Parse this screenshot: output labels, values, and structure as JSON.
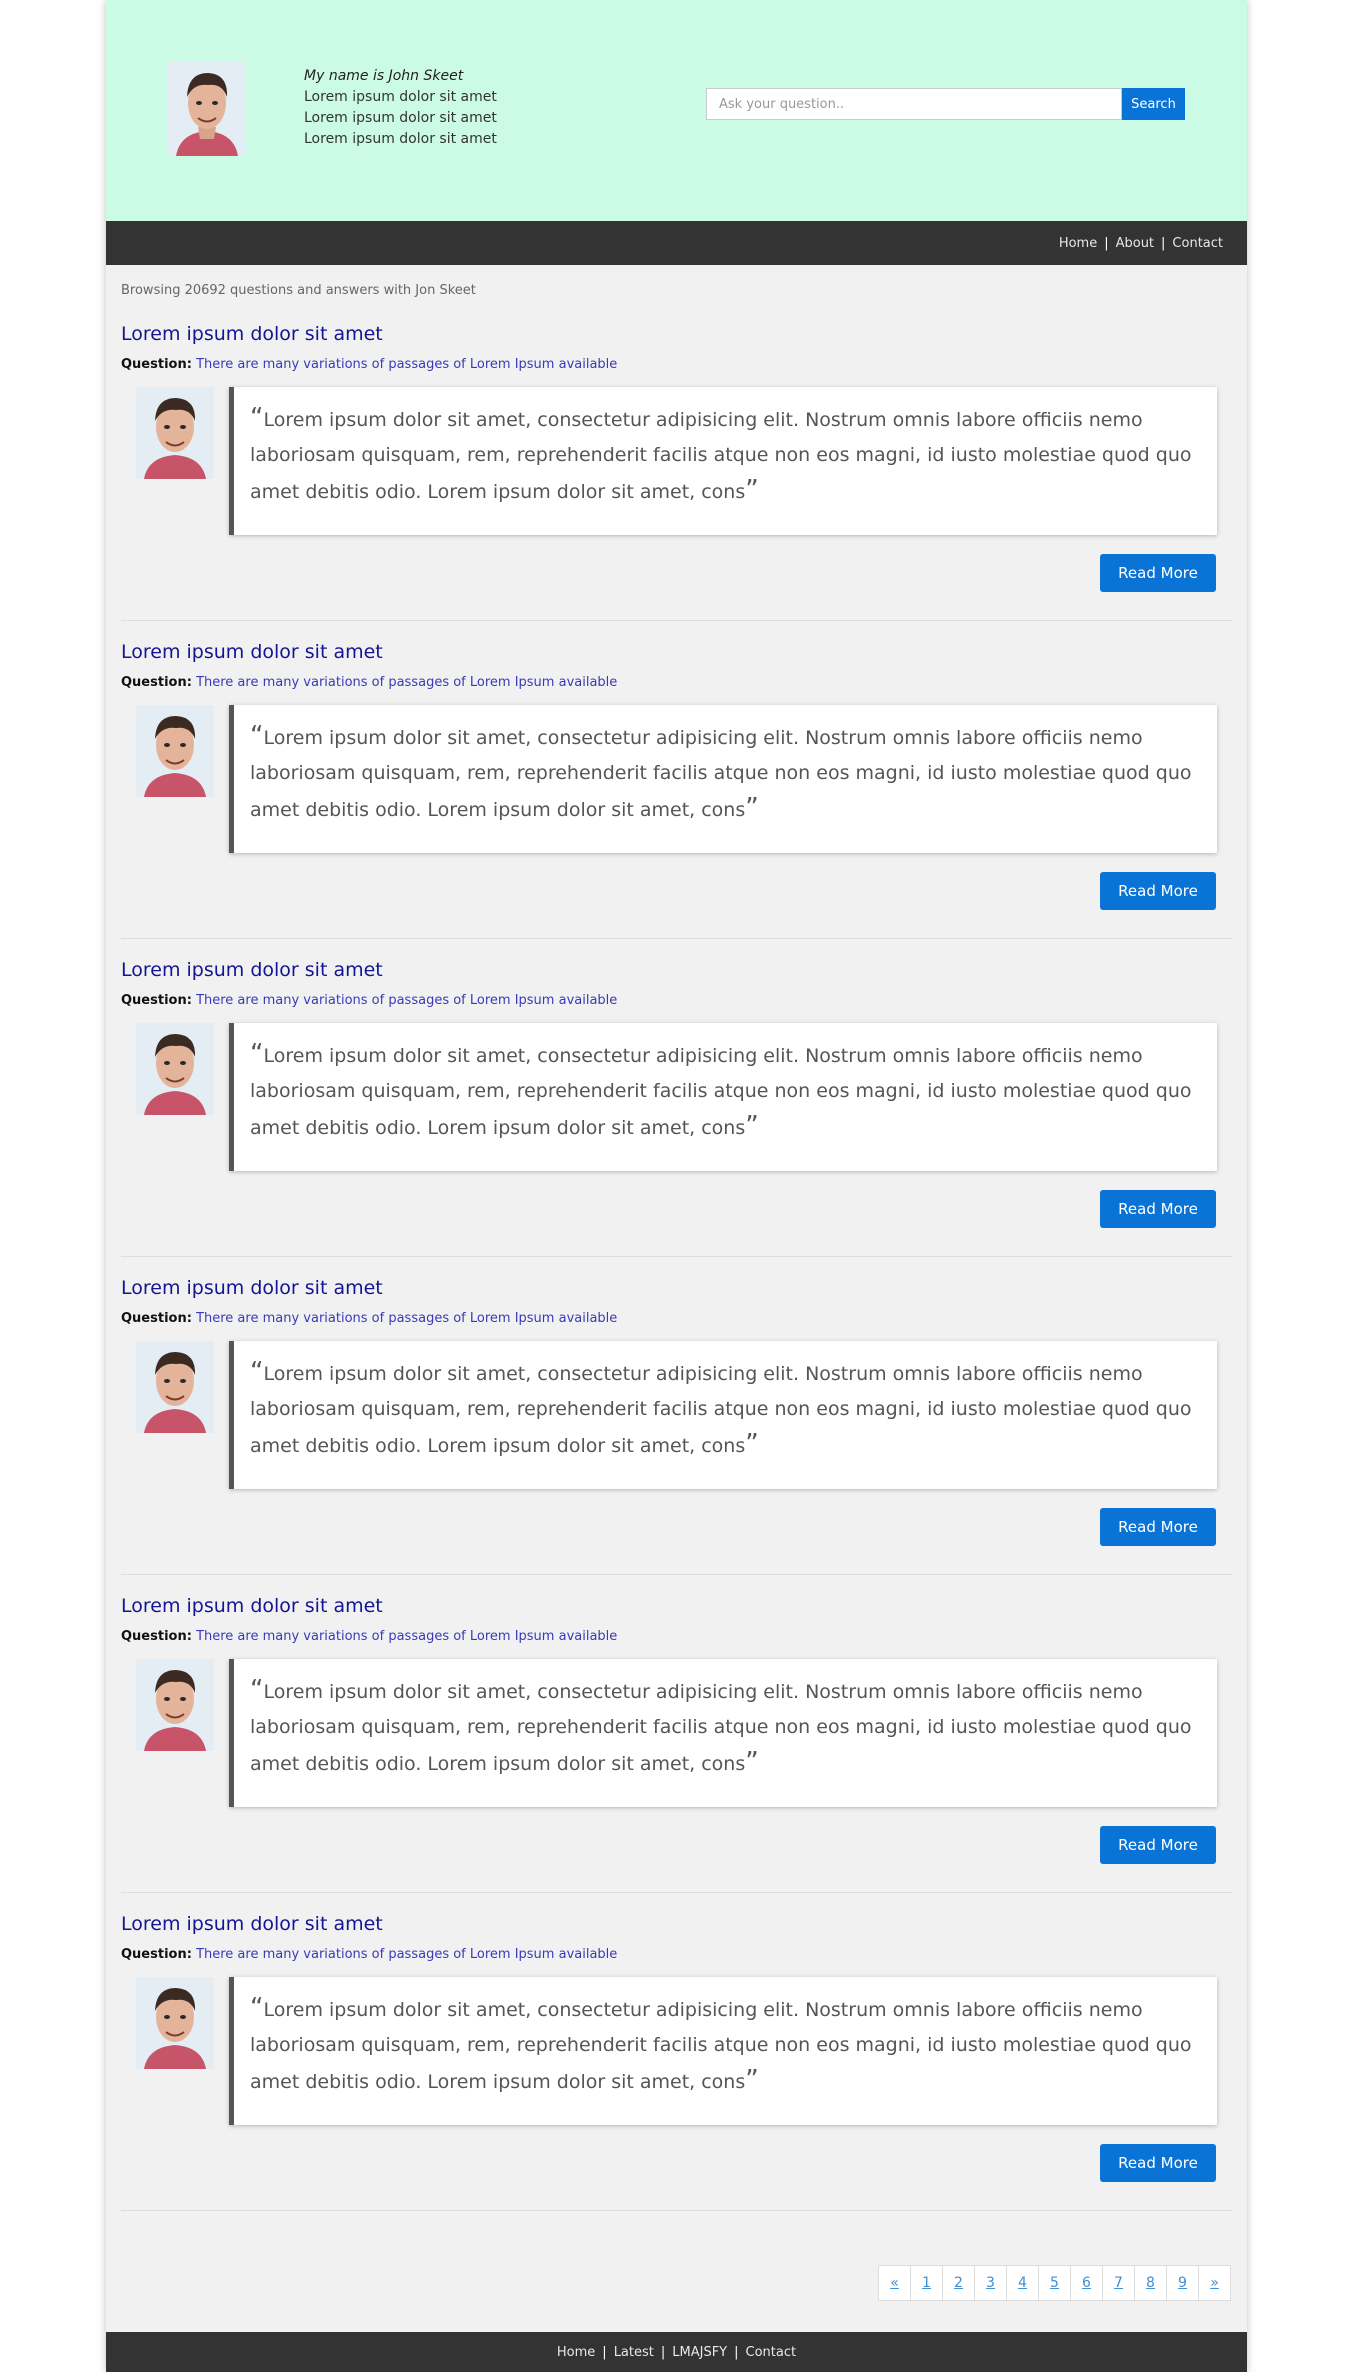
{
  "header": {
    "name": "My name is John Skeet",
    "bio_lines": [
      "Lorem ipsum dolor sit amet",
      "Lorem ipsum dolor sit amet",
      "Lorem ipsum dolor sit amet"
    ],
    "search_placeholder": "Ask your question..",
    "search_button": "Search"
  },
  "nav": {
    "items": [
      "Home",
      "About",
      "Contact"
    ]
  },
  "browse_text": "Browsing 20692 questions and answers with Jon Skeet",
  "qa_items": [
    {
      "title": "Lorem ipsum dolor sit amet",
      "question_label": "Question:",
      "question": "There are many variations of passages of Lorem Ipsum available",
      "answer": "Lorem ipsum dolor sit amet, consectetur adipisicing elit. Nostrum omnis labore officiis nemo laboriosam quisquam, rem, reprehenderit facilis atque non eos magni, id iusto molestiae quod quo amet debitis odio. Lorem ipsum dolor sit amet, cons",
      "button": "Read More"
    },
    {
      "title": "Lorem ipsum dolor sit amet",
      "question_label": "Question:",
      "question": "There are many variations of passages of Lorem Ipsum available",
      "answer": "Lorem ipsum dolor sit amet, consectetur adipisicing elit. Nostrum omnis labore officiis nemo laboriosam quisquam, rem, reprehenderit facilis atque non eos magni, id iusto molestiae quod quo amet debitis odio. Lorem ipsum dolor sit amet, cons",
      "button": "Read More"
    },
    {
      "title": "Lorem ipsum dolor sit amet",
      "question_label": "Question:",
      "question": "There are many variations of passages of Lorem Ipsum available",
      "answer": "Lorem ipsum dolor sit amet, consectetur adipisicing elit. Nostrum omnis labore officiis nemo laboriosam quisquam, rem, reprehenderit facilis atque non eos magni, id iusto molestiae quod quo amet debitis odio. Lorem ipsum dolor sit amet, cons",
      "button": "Read More"
    },
    {
      "title": "Lorem ipsum dolor sit amet",
      "question_label": "Question:",
      "question": "There are many variations of passages of Lorem Ipsum available",
      "answer": "Lorem ipsum dolor sit amet, consectetur adipisicing elit. Nostrum omnis labore officiis nemo laboriosam quisquam, rem, reprehenderit facilis atque non eos magni, id iusto molestiae quod quo amet debitis odio. Lorem ipsum dolor sit amet, cons",
      "button": "Read More"
    },
    {
      "title": "Lorem ipsum dolor sit amet",
      "question_label": "Question:",
      "question": "There are many variations of passages of Lorem Ipsum available",
      "answer": "Lorem ipsum dolor sit amet, consectetur adipisicing elit. Nostrum omnis labore officiis nemo laboriosam quisquam, rem, reprehenderit facilis atque non eos magni, id iusto molestiae quod quo amet debitis odio. Lorem ipsum dolor sit amet, cons",
      "button": "Read More"
    },
    {
      "title": "Lorem ipsum dolor sit amet",
      "question_label": "Question:",
      "question": "There are many variations of passages of Lorem Ipsum available",
      "answer": "Lorem ipsum dolor sit amet, consectetur adipisicing elit. Nostrum omnis labore officiis nemo laboriosam quisquam, rem, reprehenderit facilis atque non eos magni, id iusto molestiae quod quo amet debitis odio. Lorem ipsum dolor sit amet, cons",
      "button": "Read More"
    }
  ],
  "pagination": [
    "«",
    "1",
    "2",
    "3",
    "4",
    "5",
    "6",
    "7",
    "8",
    "9",
    "»"
  ],
  "footer": {
    "items": [
      "Home",
      "Latest",
      "LMAJSFY",
      "Contact"
    ]
  },
  "colors": {
    "header_bg": "#ccfbe5",
    "nav_bg": "#333333",
    "accent": "#0a74d6",
    "title": "#141494"
  }
}
